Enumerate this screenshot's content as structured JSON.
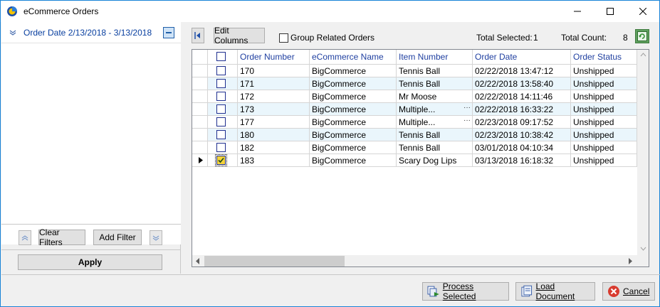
{
  "window": {
    "title": "eCommerce Orders"
  },
  "filters": {
    "order_date_label": "Order Date 2/13/2018 - 3/13/2018",
    "clear_label": "Clear Filters",
    "add_label": "Add Filter",
    "apply_label": "Apply"
  },
  "toolbar": {
    "edit_columns_label": "Edit Columns",
    "group_related_label": "Group Related Orders",
    "group_related_checked": false,
    "total_selected_label": "Total Selected:",
    "total_selected_value": "1",
    "total_count_label": "Total Count:",
    "total_count_value": "8"
  },
  "grid": {
    "columns": [
      "Order Number",
      "eCommerce Name",
      "Item Number",
      "Order Date",
      "Order Status"
    ],
    "rows": [
      {
        "order": "170",
        "name": "BigCommerce",
        "item": "Tennis Ball",
        "date": "02/22/2018 13:47:12",
        "status": "Unshipped",
        "checked": false,
        "ellipsis": false
      },
      {
        "order": "171",
        "name": "BigCommerce",
        "item": "Tennis Ball",
        "date": "02/22/2018 13:58:40",
        "status": "Unshipped",
        "checked": false,
        "ellipsis": false
      },
      {
        "order": "172",
        "name": "BigCommerce",
        "item": "Mr Moose",
        "date": "02/22/2018 14:11:46",
        "status": "Unshipped",
        "checked": false,
        "ellipsis": false
      },
      {
        "order": "173",
        "name": "BigCommerce",
        "item": "Multiple...",
        "date": "02/22/2018 16:33:22",
        "status": "Unshipped",
        "checked": false,
        "ellipsis": true
      },
      {
        "order": "177",
        "name": "BigCommerce",
        "item": "Multiple...",
        "date": "02/23/2018 09:17:52",
        "status": "Unshipped",
        "checked": false,
        "ellipsis": true
      },
      {
        "order": "180",
        "name": "BigCommerce",
        "item": "Tennis Ball",
        "date": "02/23/2018 10:38:42",
        "status": "Unshipped",
        "checked": false,
        "ellipsis": false
      },
      {
        "order": "182",
        "name": "BigCommerce",
        "item": "Tennis Ball",
        "date": "03/01/2018 04:10:34",
        "status": "Unshipped",
        "checked": false,
        "ellipsis": false
      },
      {
        "order": "183",
        "name": "BigCommerce",
        "item": "Scary Dog Lips",
        "date": "03/13/2018 16:18:32",
        "status": "Unshipped",
        "checked": true,
        "ellipsis": false
      }
    ],
    "ellipsis_glyph": "···"
  },
  "actions": {
    "process_label": "Process Selected",
    "load_label": "Load Document",
    "cancel_label": "Cancel"
  },
  "colors": {
    "accent": "#1883d7",
    "header_text": "#1f3fa0",
    "alt_row": "#eaf6fc",
    "filter_text": "#0a40a0"
  }
}
